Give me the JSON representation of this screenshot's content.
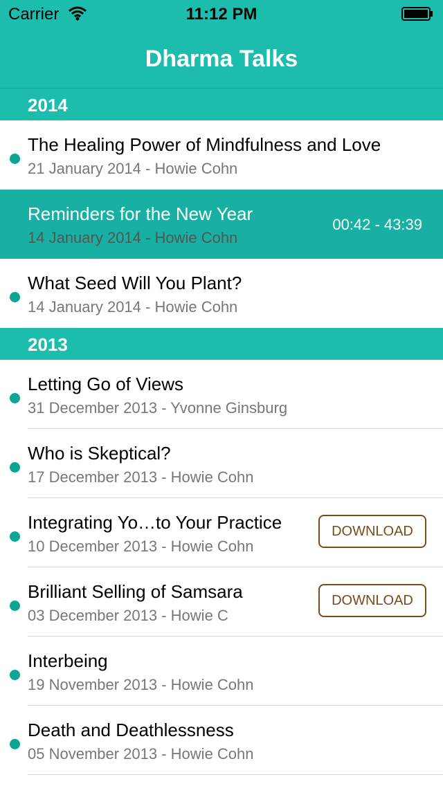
{
  "status_bar": {
    "carrier": "Carrier",
    "time": "11:12 PM"
  },
  "nav": {
    "title": "Dharma Talks"
  },
  "sections": [
    {
      "year": "2014",
      "rows": [
        {
          "title": "The Healing Power of Mindfulness and Love",
          "subtitle": "21 January 2014 - Howie Cohn"
        },
        {
          "title": "Reminders for the New Year",
          "subtitle": "14 January 2014 - Howie Cohn",
          "time": "00:42 - 43:39"
        },
        {
          "title": "What Seed Will You Plant?",
          "subtitle": "14 January 2014 - Howie Cohn"
        }
      ]
    },
    {
      "year": "2013",
      "rows": [
        {
          "title": "Letting Go of Views",
          "subtitle": "31 December 2013 - Yvonne Ginsburg"
        },
        {
          "title": "Who is Skeptical?",
          "subtitle": "17 December 2013 - Howie Cohn"
        },
        {
          "title": "Integrating Yo…to Your Practice",
          "subtitle": "10 December 2013 - Howie Cohn",
          "button": "DOWNLOAD"
        },
        {
          "title": "Brilliant Selling of Samsara",
          "subtitle": "03 December 2013 - Howie C",
          "button": "DOWNLOAD"
        },
        {
          "title": "Interbeing",
          "subtitle": "19 November 2013 - Howie Cohn"
        },
        {
          "title": "Death and Deathlessness",
          "subtitle": "05 November 2013 - Howie Cohn"
        }
      ]
    }
  ],
  "colors": {
    "accent": "#1dbdae",
    "playing_row": "#17b0a2",
    "dot": "#0fa594",
    "download": "#7b4a1a"
  }
}
